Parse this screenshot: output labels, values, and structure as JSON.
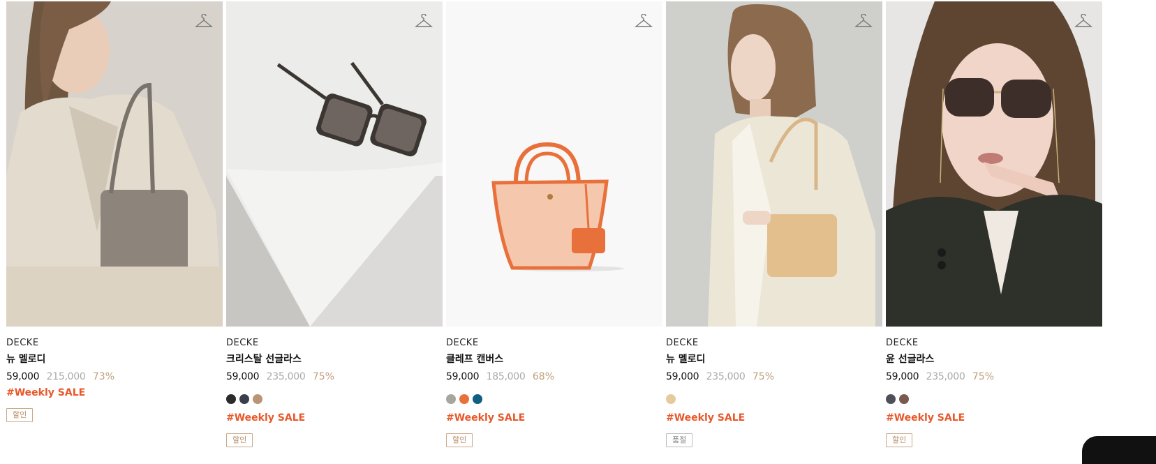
{
  "products": [
    {
      "brand": "DECKE",
      "name": "뉴 멜로디",
      "price": "59,000",
      "original_price": "215,000",
      "discount": "73%",
      "tag": "#Weekly SALE",
      "badge": "할인",
      "image": "woman-beige-suit-gray-bag",
      "swatches": []
    },
    {
      "brand": "DECKE",
      "name": "크리스탈 선글라스",
      "price": "59,000",
      "original_price": "235,000",
      "discount": "75%",
      "tag": "#Weekly SALE",
      "badge": "할인",
      "image": "sunglasses-on-white-block",
      "swatches": [
        "#2b2b2b",
        "#3a3f4a",
        "#b99573"
      ]
    },
    {
      "brand": "DECKE",
      "name": "클레프 캔버스",
      "price": "59,000",
      "original_price": "185,000",
      "discount": "68%",
      "tag": "#Weekly SALE",
      "badge": "할인",
      "image": "orange-canvas-tote",
      "swatches": [
        "#a8a69c",
        "#e8703a",
        "#0f5f80"
      ]
    },
    {
      "brand": "DECKE",
      "name": "뉴 멜로디",
      "price": "59,000",
      "original_price": "235,000",
      "discount": "75%",
      "tag": "#Weekly SALE",
      "badge": "품절",
      "image": "woman-cream-blazer-tan-bag",
      "swatches": [
        "#e6c99d"
      ]
    },
    {
      "brand": "DECKE",
      "name": "윤 선글라스",
      "price": "59,000",
      "original_price": "235,000",
      "discount": "75%",
      "tag": "#Weekly SALE",
      "badge": "할인",
      "image": "woman-dark-sunglasses",
      "swatches": [
        "#4f4f5a",
        "#7a5a50"
      ]
    }
  ],
  "icons": {
    "wishlist": "hanger-icon"
  },
  "colors": {
    "sale_tag": "#e8582a",
    "discount": "#c0a07e",
    "badge_sale": "#b58a64"
  }
}
